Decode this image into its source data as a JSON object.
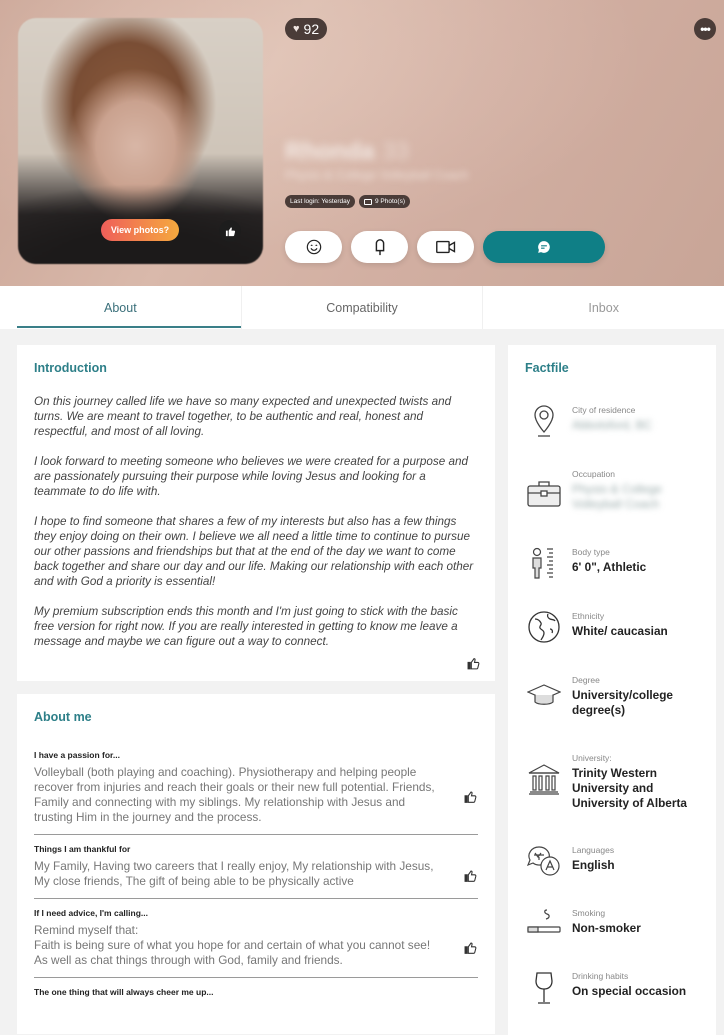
{
  "header": {
    "score": "92",
    "name": "Rhonda",
    "age": "33",
    "subtitle": "Physio & College Volleyball Coach",
    "last_login": "Last login: Yesterday",
    "photos_count": "9 Photo(s)",
    "view_photos_label": "View photos?",
    "accent_color": "#0f7f86"
  },
  "tabs": [
    {
      "label": "About",
      "active": true
    },
    {
      "label": "Compatibility",
      "active": false
    },
    {
      "label": "Inbox",
      "active": false
    }
  ],
  "introduction": {
    "title": "Introduction",
    "paragraphs": [
      "On this journey called life we have so many expected and unexpected twists and turns. We are meant to travel together, to be authentic and real, honest and respectful, and most of all loving.",
      "I look forward to meeting someone who believes we were created for a purpose and are passionately pursuing their purpose while loving Jesus and looking for a teammate to do life with.",
      "I hope to find someone that shares a few of my interests but also has a few things they enjoy doing on their own. I believe we all need a little time to continue to pursue our other passions and friendships but that at the end of the day we want to come back together and share our day and our life. Making our relationship with each other and with God a priority is essential!",
      "My premium subscription ends this month and I'm just going to stick with the basic free version for right now. If you are really interested in getting to know me leave a message and maybe we can figure out a way to connect."
    ]
  },
  "about_me": {
    "title": "About me",
    "items": [
      {
        "question": "I have a passion for...",
        "answer": "Volleyball (both playing and coaching). Physiotherapy and helping people recover from injuries and reach their goals or their new full potential. Friends, Family and connecting with my siblings. My relationship with Jesus and trusting Him in the journey and the process."
      },
      {
        "question": "Things I am thankful for",
        "answer": "My Family, Having two careers that I really enjoy, My relationship with Jesus, My close friends, The gift of being able to be physically active"
      },
      {
        "question": "If I need advice, I'm calling...",
        "answer": "Remind myself that:\nFaith is being sure of what you hope for and certain of what you cannot see!\nAs well as chat things through with God, family and friends."
      },
      {
        "question": "The one thing that will always cheer me up...",
        "answer": ""
      }
    ]
  },
  "factfile": {
    "title": "Factfile",
    "items": [
      {
        "icon": "location-pin-icon",
        "label": "City of residence",
        "value": "Abbotsford, BC",
        "blurred": true
      },
      {
        "icon": "briefcase-icon",
        "label": "Occupation",
        "value": "Physio & College Volleyball Coach",
        "blurred": true
      },
      {
        "icon": "body-height-icon",
        "label": "Body type",
        "value": "6' 0\", Athletic",
        "blurred": false
      },
      {
        "icon": "globe-icon",
        "label": "Ethnicity",
        "value": "White/ caucasian",
        "blurred": false
      },
      {
        "icon": "graduation-cap-icon",
        "label": "Degree",
        "value": "University/college degree(s)",
        "blurred": false
      },
      {
        "icon": "university-building-icon",
        "label": "University:",
        "value": "Trinity Western University and University of Alberta",
        "blurred": false
      },
      {
        "icon": "languages-icon",
        "label": "Languages",
        "value": "English",
        "blurred": false
      },
      {
        "icon": "cigarette-icon",
        "label": "Smoking",
        "value": "Non-smoker",
        "blurred": false
      },
      {
        "icon": "wine-glass-icon",
        "label": "Drinking habits",
        "value": "On special occasion",
        "blurred": false
      }
    ]
  }
}
